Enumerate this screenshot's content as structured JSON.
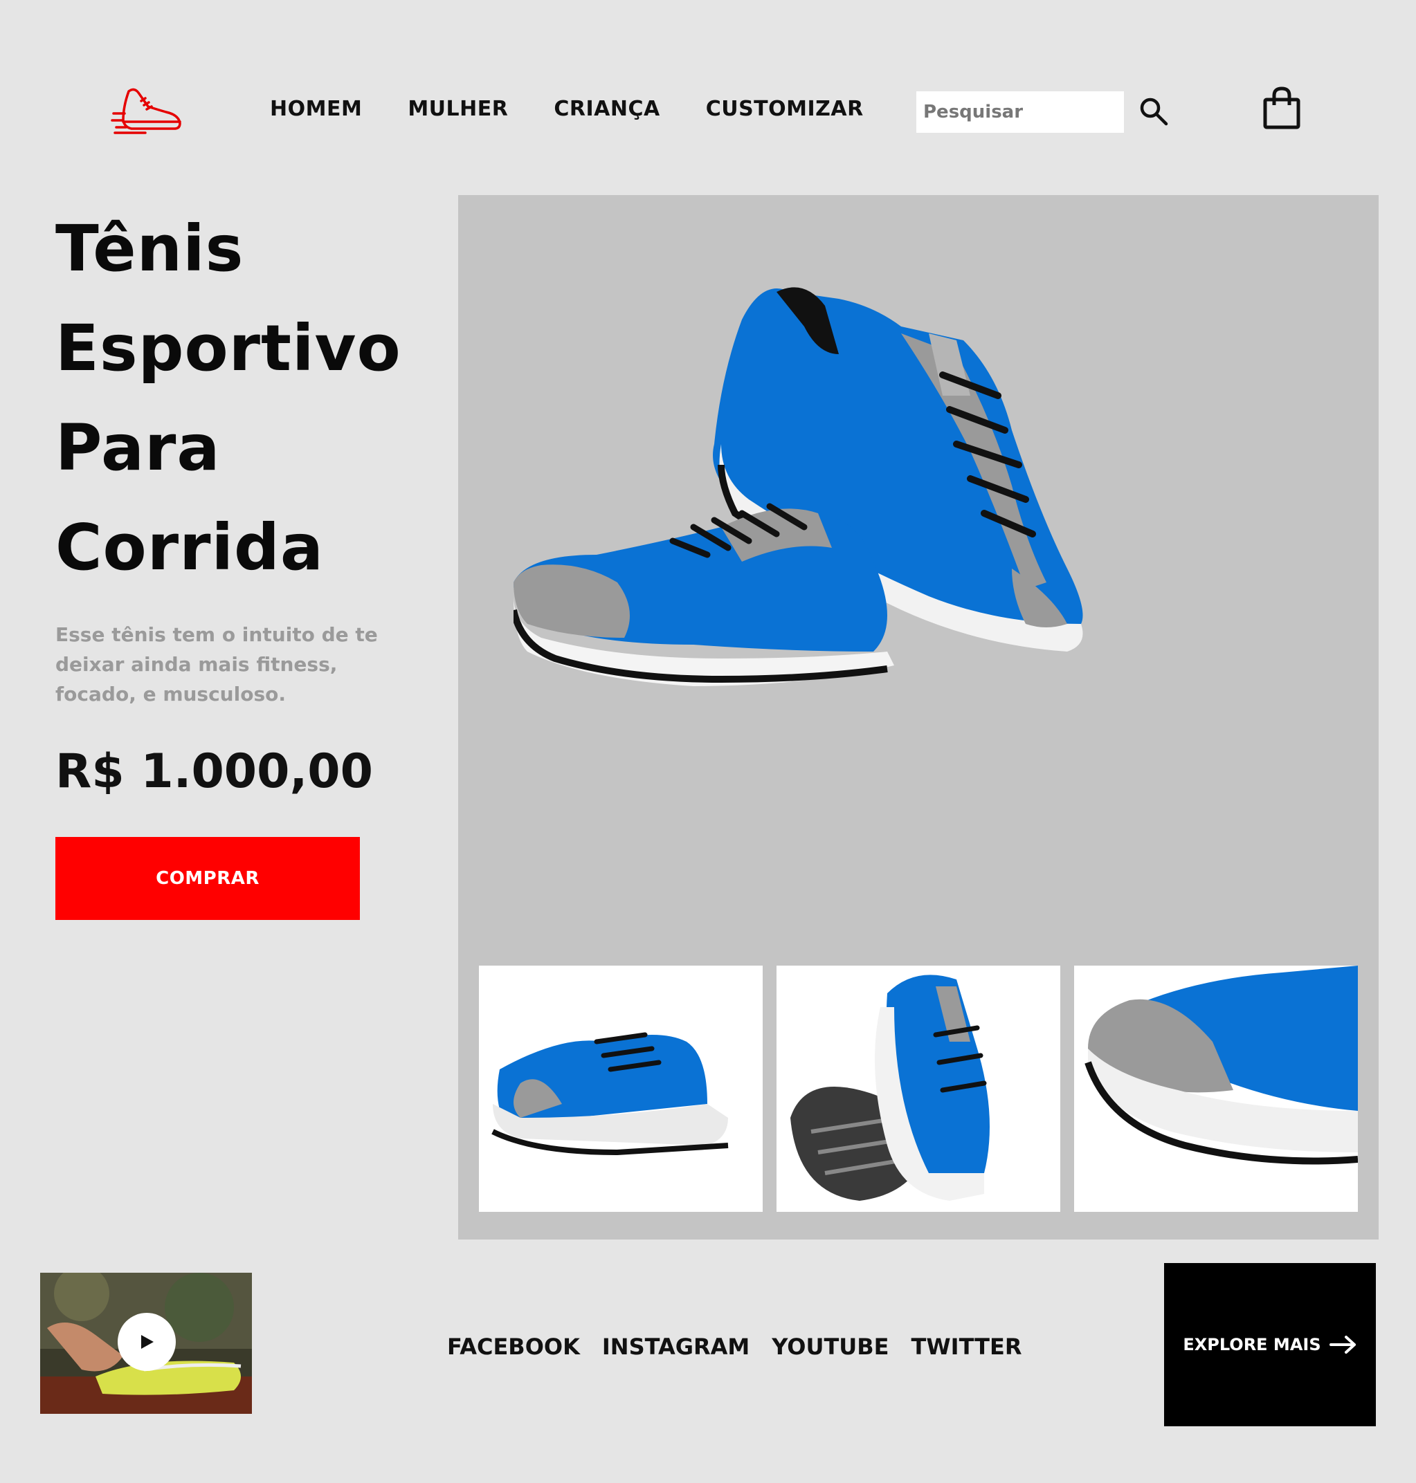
{
  "header": {
    "logo_icon": "running-shoe-icon",
    "nav": [
      "HOMEM",
      "MULHER",
      "CRIANÇA",
      "CUSTOMIZAR"
    ],
    "search_placeholder": "Pesquisar",
    "search_icon": "search-icon",
    "cart_icon": "shopping-bag-icon"
  },
  "hero": {
    "title_lines": [
      "Tênis",
      "Esportivo",
      "Para",
      "Corrida"
    ],
    "description": "Esse tênis tem o intuito de te deixar ainda mais fitness, focado, e musculoso.",
    "price": "R$ 1.000,00",
    "buy_label": "COMPRAR"
  },
  "footer": {
    "social": [
      "FACEBOOK",
      "INSTAGRAM",
      "YOUTUBE",
      "TWITTER"
    ],
    "explore_label": "EXPLORE MAIS",
    "play_icon": "play-icon"
  },
  "colors": {
    "accent": "#ff0000",
    "background": "#e5e5e5",
    "gallery_bg": "#c4c4c4",
    "shoe_blue": "#0a72d4"
  }
}
